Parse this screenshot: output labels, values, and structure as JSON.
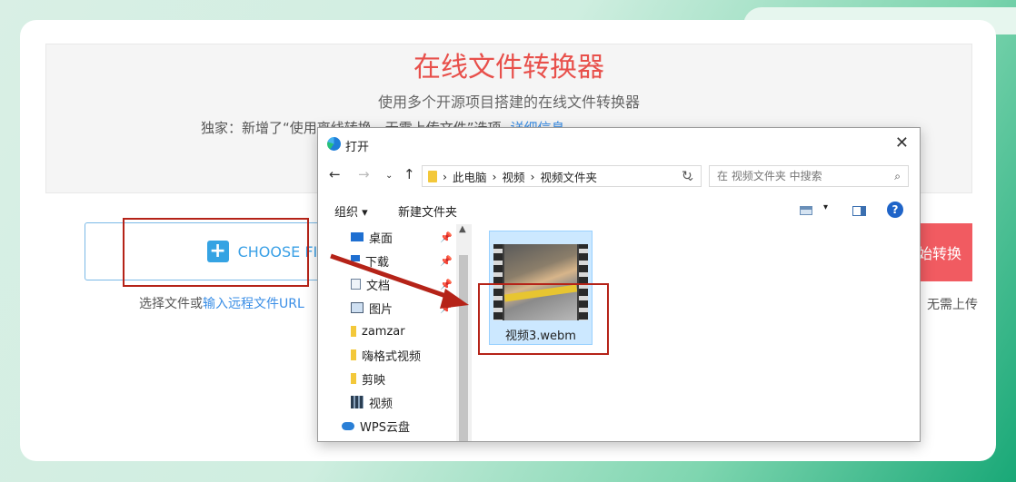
{
  "page": {
    "title": "在线文件转换器",
    "subtitle": "使用多个开源项目搭建的在线文件转换器",
    "exclusive_text": "独家：新增了“使用离线转换，无需上传文件”选项",
    "details_link": "详细信息",
    "choose_files_label": "CHOOSE FILES",
    "hint_prefix": "选择文件或",
    "hint_link": "输入远程文件URL",
    "start_label": "始转换",
    "no_upload_text": "无需上传"
  },
  "dialog": {
    "title": "打开",
    "path": [
      "此电脑",
      "视频",
      "视频文件夹"
    ],
    "search_placeholder": "在 视频文件夹 中搜索",
    "toolbar": {
      "organize": "组织 ▾",
      "new_folder": "新建文件夹"
    },
    "sidebar": [
      {
        "label": "桌面",
        "icon": "desktop-icon",
        "pinned": true
      },
      {
        "label": "下载",
        "icon": "download-icon",
        "pinned": true
      },
      {
        "label": "文档",
        "icon": "document-icon",
        "pinned": true
      },
      {
        "label": "图片",
        "icon": "picture-icon",
        "pinned": true
      },
      {
        "label": "zamzar",
        "icon": "folder-icon",
        "pinned": false
      },
      {
        "label": "嗨格式视频",
        "icon": "folder-icon",
        "pinned": false
      },
      {
        "label": "剪映",
        "icon": "folder-icon",
        "pinned": false
      },
      {
        "label": "视频",
        "icon": "video-folder-icon",
        "pinned": false
      },
      {
        "label": "WPS云盘",
        "icon": "cloud-icon",
        "pinned": false
      }
    ],
    "file": {
      "name": "视频3.webm",
      "icon": "video-thumbnail"
    }
  },
  "colors": {
    "title_red": "#e8504b",
    "link_blue": "#3a8ee6",
    "annotation_red": "#b52318",
    "start_button": "#f15b61"
  }
}
